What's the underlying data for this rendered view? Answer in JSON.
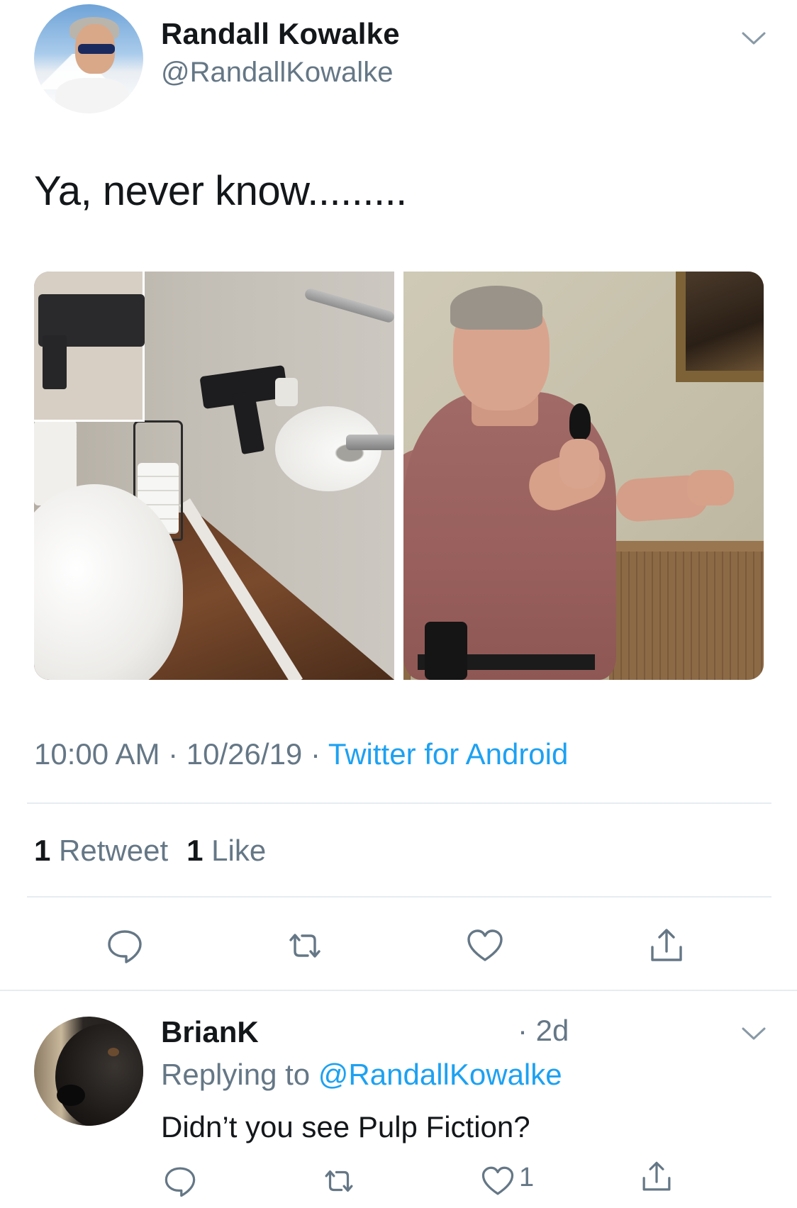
{
  "tweet": {
    "author_name": "Randall Kowalke",
    "author_handle": "@RandallKowalke",
    "text": "Ya, never know.........",
    "time": "10:00 AM",
    "separator": " · ",
    "date": "10/26/19",
    "source": "Twitter for Android",
    "retweet_count": "1",
    "retweet_label": "Retweet",
    "like_count": "1",
    "like_label": "Like"
  },
  "reply": {
    "author_name": "BrianK",
    "time": "· 2d",
    "replying_prefix": "Replying to ",
    "replying_to": "@RandallKowalke",
    "text": "Didn’t you see Pulp Fiction?",
    "like_count": "1"
  },
  "colors": {
    "text": "#14171a",
    "secondary": "#657786",
    "link": "#1da1f2",
    "divider": "#e6ecf0",
    "icon": "#657786"
  },
  "icons": {
    "reply": "speech-bubble-icon",
    "retweet": "retweet-arrows-icon",
    "like": "heart-icon",
    "share": "share-upload-icon",
    "more": "chevron-down-icon"
  }
}
